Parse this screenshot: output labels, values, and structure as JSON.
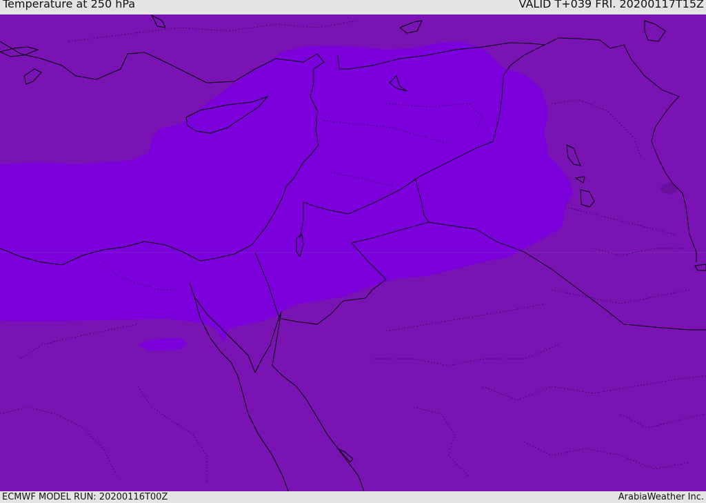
{
  "header": {
    "title": "Temperature at 250 hPa",
    "valid_time": "VALID T+039 FRI. 20200117T15Z"
  },
  "footer": {
    "model_run": "ECMWF MODEL RUN: 20200116T00Z",
    "credit": "ArabiaWeather Inc."
  },
  "map": {
    "colors": {
      "background_band": "#7a13b4",
      "warm_band": "#7c00dc",
      "cold_spot": "#6b0f9e",
      "coastline": "#000000",
      "border": "#000000",
      "province_line": "#2a0a45",
      "header_bg": "#e4e4e4"
    }
  }
}
